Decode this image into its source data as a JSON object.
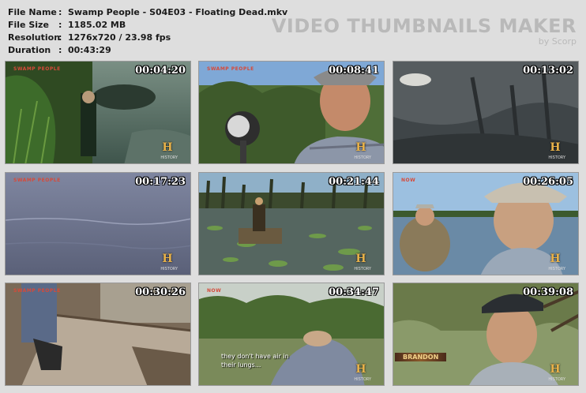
{
  "info": {
    "rows": [
      {
        "key": "File Name",
        "sep": ":",
        "value": "Swamp People - S04E03 - Floating Dead.mkv"
      },
      {
        "key": "File Size",
        "sep": ":",
        "value": "1185.02 MB"
      },
      {
        "key": "Resolution",
        "sep": ":",
        "value": "1276x720 / 23.98 fps"
      },
      {
        "key": "Duration",
        "sep": ":",
        "value": "00:43:29"
      }
    ]
  },
  "brand": {
    "title": "VIDEO THUMBNAILS MAKER",
    "subtitle": "by Scorp"
  },
  "thumbnails": [
    {
      "time": "00:04:20",
      "logo": "H",
      "logo_sub": "HISTORY",
      "show_logo": "SWAMP PEOPLE"
    },
    {
      "time": "00:08:41",
      "logo": "H",
      "logo_sub": "HISTORY",
      "show_logo": "SWAMP PEOPLE"
    },
    {
      "time": "00:13:02",
      "logo": "H",
      "logo_sub": "HISTORY"
    },
    {
      "time": "00:17:23",
      "logo": "H",
      "logo_sub": "HISTORY",
      "show_logo": "SWAMP PEOPLE"
    },
    {
      "time": "00:21:44",
      "logo": "H",
      "logo_sub": "HISTORY"
    },
    {
      "time": "00:26:05",
      "logo": "H",
      "logo_sub": "HISTORY",
      "show_logo": "NOW"
    },
    {
      "time": "00:30:26",
      "logo": "",
      "logo_sub": "",
      "show_logo": "SWAMP PEOPLE"
    },
    {
      "time": "00:34:47",
      "logo": "H",
      "logo_sub": "HISTORY",
      "show_logo": "NOW",
      "caption_line1": "they don't have air in",
      "caption_line2": "their lungs..."
    },
    {
      "time": "00:39:08",
      "logo": "H",
      "logo_sub": "HISTORY",
      "name_tag": "BRANDON"
    }
  ]
}
